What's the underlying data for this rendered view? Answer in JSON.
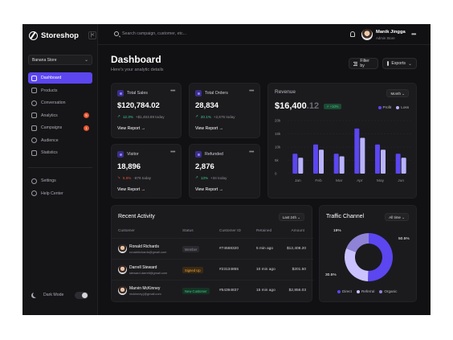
{
  "app": {
    "name": "Storeshop",
    "collapse_icon": "collapse-icon"
  },
  "sidebar": {
    "store_selector": "Banana Store",
    "items": [
      {
        "label": "Dashboard",
        "icon": "home-icon",
        "active": true
      },
      {
        "label": "Products",
        "icon": "box-icon"
      },
      {
        "label": "Conversation",
        "icon": "chat-icon"
      },
      {
        "label": "Analytics",
        "icon": "chart-icon",
        "badge": "5"
      },
      {
        "label": "Campaigns",
        "icon": "megaphone-icon",
        "badge": "1"
      },
      {
        "label": "Audience",
        "icon": "users-icon"
      },
      {
        "label": "Statistics",
        "icon": "stats-icon"
      }
    ],
    "bottom_items": [
      {
        "label": "Settings",
        "icon": "gear-icon"
      },
      {
        "label": "Help Center",
        "icon": "help-icon"
      }
    ],
    "dark_mode_label": "Dark Mode",
    "dark_mode_on": true
  },
  "topbar": {
    "search_placeholder": "Search campaign, customer, etc...",
    "user_name": "Manik Jingga",
    "user_role": "Admin Store"
  },
  "header": {
    "title": "Dashboard",
    "subtitle": "Here's your analytic details",
    "filter_label": "Filter by",
    "exports_label": "Exports"
  },
  "stats": [
    {
      "label": "Total Sales",
      "value": "$120,784.02",
      "pct": "12.3%",
      "dir": "up",
      "rest": "+$1,453.89 today",
      "link": "View Report"
    },
    {
      "label": "Total Orders",
      "value": "28,834",
      "pct": "20.1%",
      "dir": "up",
      "rest": "+2,676 today",
      "link": "View Report"
    },
    {
      "label": "Visitor",
      "value": "18,896",
      "pct": "5.6%",
      "dir": "down",
      "rest": "-876 today",
      "link": "View Report"
    },
    {
      "label": "Refunded",
      "value": "2,876",
      "pct": "13%",
      "dir": "up",
      "rest": "+34 today",
      "link": "View Report"
    }
  ],
  "revenue": {
    "title": "Revenue",
    "value_main": "$16,400",
    "value_dec": ".12",
    "change": "+10%",
    "period": "Month",
    "legend": [
      {
        "label": "Profit",
        "color": "#5b46f0"
      },
      {
        "label": "Loss",
        "color": "#b9b3ff"
      }
    ]
  },
  "chart_data": {
    "type": "bar",
    "categories": [
      "Jan",
      "Feb",
      "Mar",
      "Apr",
      "May",
      "Jun"
    ],
    "series": [
      {
        "name": "Profit",
        "values": [
          7.5,
          11,
          7.5,
          17,
          11,
          7.5
        ]
      },
      {
        "name": "Loss",
        "values": [
          6,
          9,
          6.5,
          13.5,
          9,
          6
        ]
      }
    ],
    "y_ticks": [
      "20k",
      "15k",
      "10k",
      "5k",
      "0"
    ],
    "ylim": [
      0,
      20
    ]
  },
  "recent_activity": {
    "title": "Recent Activity",
    "filter": "Last 24h",
    "columns": [
      "Customer",
      "Status",
      "Customer ID",
      "Retained",
      "Amount"
    ],
    "rows": [
      {
        "name": "Ronald Richards",
        "email": "ronaldrichards@gmail.com",
        "status": "Member",
        "status_color": "#8d8d97",
        "status_bg": "#2a2a2e",
        "id": "#74568320",
        "retained": "5 min ago",
        "amount": "$12,408.20"
      },
      {
        "name": "Darrell Steward",
        "email": "steward.darrell@gmail.com",
        "status": "Signed Up",
        "status_color": "#f0a23a",
        "status_bg": "#3a2a14",
        "id": "#23134855",
        "retained": "10 min ago",
        "amount": "$201.50"
      },
      {
        "name": "Marvin McKinney",
        "email": "mckinney.j@gmail.com",
        "status": "New Customer",
        "status_color": "#3ec98a",
        "status_bg": "#163324",
        "id": "#54394837",
        "retained": "15 min ago",
        "amount": "$2,856.03"
      }
    ]
  },
  "traffic": {
    "title": "Traffic Channel",
    "filter": "All time",
    "slices": [
      {
        "label": "Direct",
        "value": 50.5,
        "color": "#5b46f0"
      },
      {
        "label": "Referral",
        "value": 30.5,
        "color": "#c9c2ff"
      },
      {
        "label": "Organic",
        "value": 19,
        "color": "#8e83d6"
      }
    ],
    "pct_labels": [
      "19%",
      "50.5%",
      "30.5%"
    ]
  }
}
